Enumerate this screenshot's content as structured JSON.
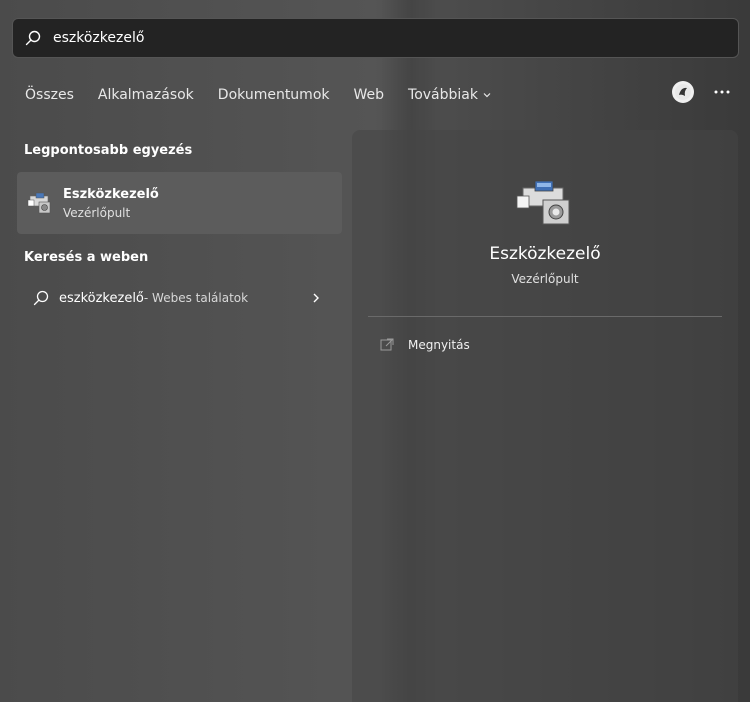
{
  "search": {
    "value": "eszközkezelő",
    "icon": "search-icon"
  },
  "tabs": [
    {
      "label": "Összes"
    },
    {
      "label": "Alkalmazások"
    },
    {
      "label": "Dokumentumok"
    },
    {
      "label": "Web"
    },
    {
      "label": "Továbbiak"
    }
  ],
  "header_icons": {
    "avatar": "account-avatar-icon",
    "more": "more-options-icon"
  },
  "best_match": {
    "section_title": "Legpontosabb egyezés",
    "name": "Eszközkezelő",
    "subtitle": "Vezérlőpult"
  },
  "web_search": {
    "section_title": "Keresés a weben",
    "query": "eszközkezelő",
    "suffix": " - Webes találatok"
  },
  "preview": {
    "title": "Eszközkezelő",
    "subtitle": "Vezérlőpult",
    "actions": [
      {
        "label": "Megnyitás"
      }
    ]
  }
}
